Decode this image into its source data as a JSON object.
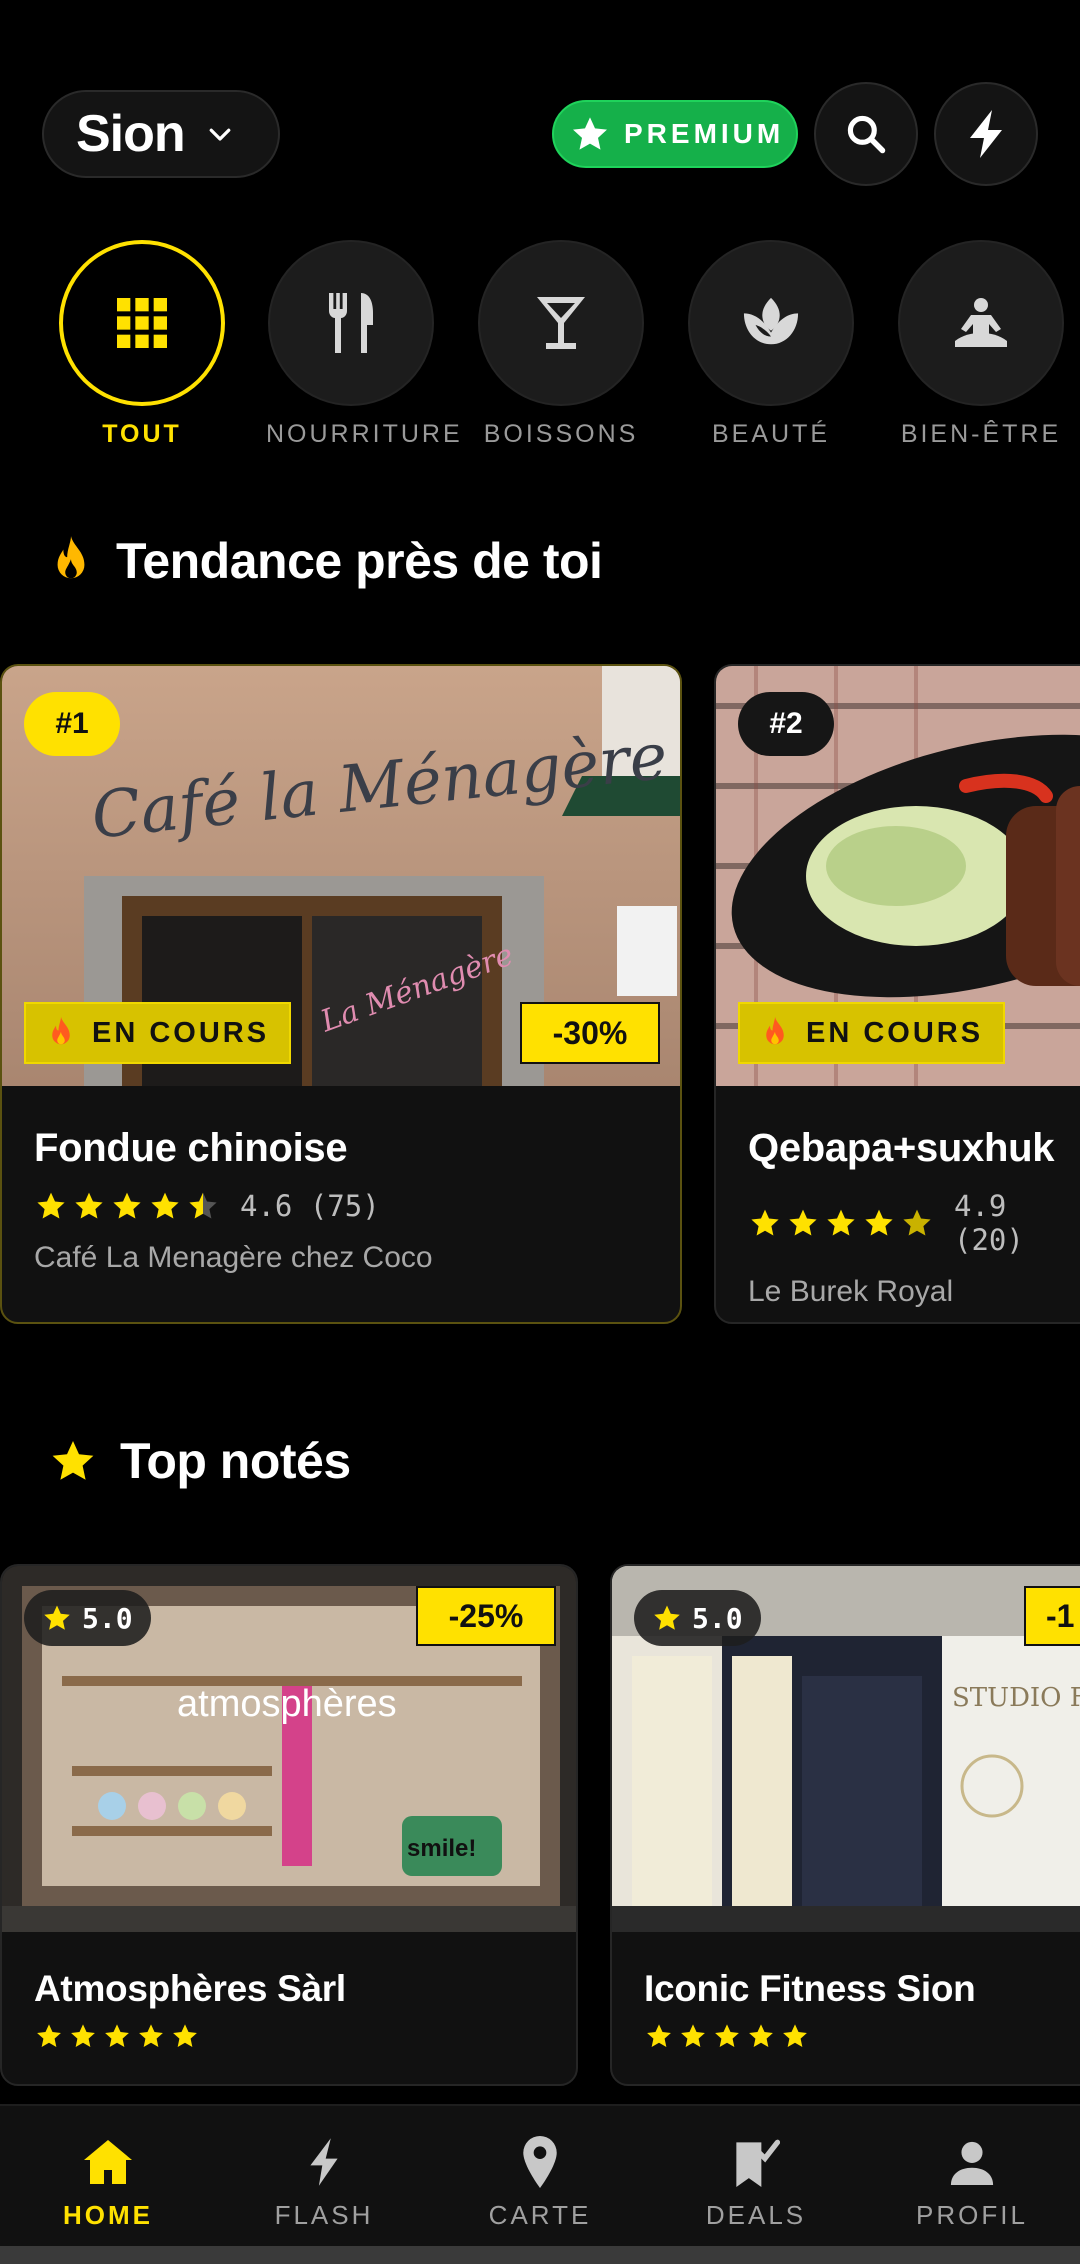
{
  "header": {
    "city": "Sion",
    "premium_label": "PREMIUM"
  },
  "categories": [
    {
      "label": "TOUT",
      "icon": "grid-icon",
      "active": true
    },
    {
      "label": "NOURRITURE",
      "icon": "fork-knife-icon",
      "active": false
    },
    {
      "label": "BOISSONS",
      "icon": "cocktail-icon",
      "active": false
    },
    {
      "label": "BEAUTÉ",
      "icon": "lotus-icon",
      "active": false
    },
    {
      "label": "BIEN-ÊTRE",
      "icon": "meditation-icon",
      "active": false
    }
  ],
  "trending": {
    "title": "Tendance près de toi",
    "cards": [
      {
        "rank": "#1",
        "status": "EN COURS",
        "discount": "-30%",
        "title": "Fondue chinoise",
        "rating_text": "4.6 (75)",
        "rating": 4.6,
        "venue": "Café La Menagère chez Coco",
        "sign_text": "Café la Ménagère",
        "door_text": "La Ménagère"
      },
      {
        "rank": "#2",
        "status": "EN COURS",
        "title": "Qebapa+suxhuk",
        "rating_text": "4.9 (20)",
        "rating": 4.9,
        "venue": "Le Burek Royal"
      }
    ]
  },
  "top_rated": {
    "title": "Top notés",
    "cards": [
      {
        "rating_badge": "5.0",
        "discount": "-25%",
        "title": "Atmosphères Sàrl",
        "rating": 5,
        "shop_text": "atmosphères",
        "small_text": "smile!"
      },
      {
        "rating_badge": "5.0",
        "discount": "-1",
        "title": "Iconic Fitness Sion",
        "rating": 5,
        "shop_text": "STUDIO FITNESS"
      }
    ]
  },
  "nav": [
    {
      "label": "HOME",
      "icon": "home-icon",
      "active": true
    },
    {
      "label": "FLASH",
      "icon": "lightning-icon",
      "active": false
    },
    {
      "label": "CARTE",
      "icon": "map-pin-icon",
      "active": false
    },
    {
      "label": "DEALS",
      "icon": "bookmark-check-icon",
      "active": false
    },
    {
      "label": "PROFIL",
      "icon": "person-icon",
      "active": false
    }
  ],
  "colors": {
    "accent": "#ffe100",
    "premium": "#15b04a",
    "background": "#000000"
  }
}
